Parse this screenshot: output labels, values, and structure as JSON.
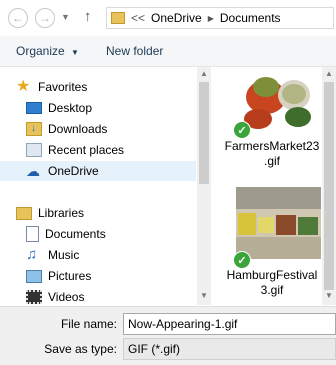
{
  "address_bar": {
    "overflow": "<<",
    "crumbs": [
      "OneDrive",
      "Documents"
    ]
  },
  "toolbar": {
    "organize_label": "Organize",
    "new_folder_label": "New folder"
  },
  "nav_pane": {
    "favorites": {
      "label": "Favorites",
      "items": [
        {
          "label": "Desktop"
        },
        {
          "label": "Downloads"
        },
        {
          "label": "Recent places"
        },
        {
          "label": "OneDrive"
        }
      ]
    },
    "libraries": {
      "label": "Libraries",
      "items": [
        {
          "label": "Documents"
        },
        {
          "label": "Music"
        },
        {
          "label": "Pictures"
        },
        {
          "label": "Videos"
        }
      ]
    }
  },
  "files": [
    {
      "line1": "FarmersMarket23",
      "line2": ".gif"
    },
    {
      "line1": "HamburgFestival",
      "line2": "3.gif"
    }
  ],
  "save_form": {
    "file_name_label": "File name:",
    "file_name_value": "Now-Appearing-1.gif",
    "save_type_label": "Save as type:",
    "save_type_value": "GIF (*.gif)"
  },
  "colors": {
    "link": "#1e3956",
    "selection": "#e5f1fb",
    "sync_check": "#3aa53a"
  }
}
